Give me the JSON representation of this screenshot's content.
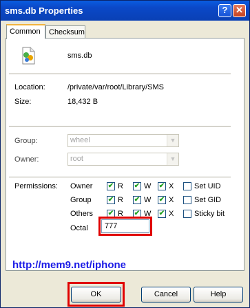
{
  "window": {
    "title": "sms.db Properties",
    "help_glyph": "?",
    "close_glyph": "✕"
  },
  "tabs": [
    {
      "label": "Common"
    },
    {
      "label": "Checksum"
    }
  ],
  "file": {
    "name": "sms.db",
    "location_label": "Location:",
    "location_value": "/private/var/root/Library/SMS",
    "size_label": "Size:",
    "size_value": "18,432 B"
  },
  "ownership": {
    "group_label": "Group:",
    "group_value": "wheel",
    "owner_label": "Owner:",
    "owner_value": "root"
  },
  "permissions": {
    "label": "Permissions:",
    "rows": [
      {
        "name": "Owner",
        "r": true,
        "w": true,
        "x": true,
        "special_label": "Set UID",
        "special": false
      },
      {
        "name": "Group",
        "r": true,
        "w": true,
        "x": true,
        "special_label": "Set GID",
        "special": false
      },
      {
        "name": "Others",
        "r": true,
        "w": true,
        "x": true,
        "special_label": "Sticky bit",
        "special": false
      }
    ],
    "col_r": "R",
    "col_w": "W",
    "col_x": "X",
    "octal_label": "Octal",
    "octal_value": "777"
  },
  "watermark_url": "http://mem9.net/iphone",
  "buttons": {
    "ok": "OK",
    "cancel": "Cancel",
    "help": "Help"
  },
  "colors": {
    "title_bar": "#0b48c7",
    "highlight_box": "#e00000",
    "link": "#1a1ae6",
    "check": "#21a121"
  }
}
